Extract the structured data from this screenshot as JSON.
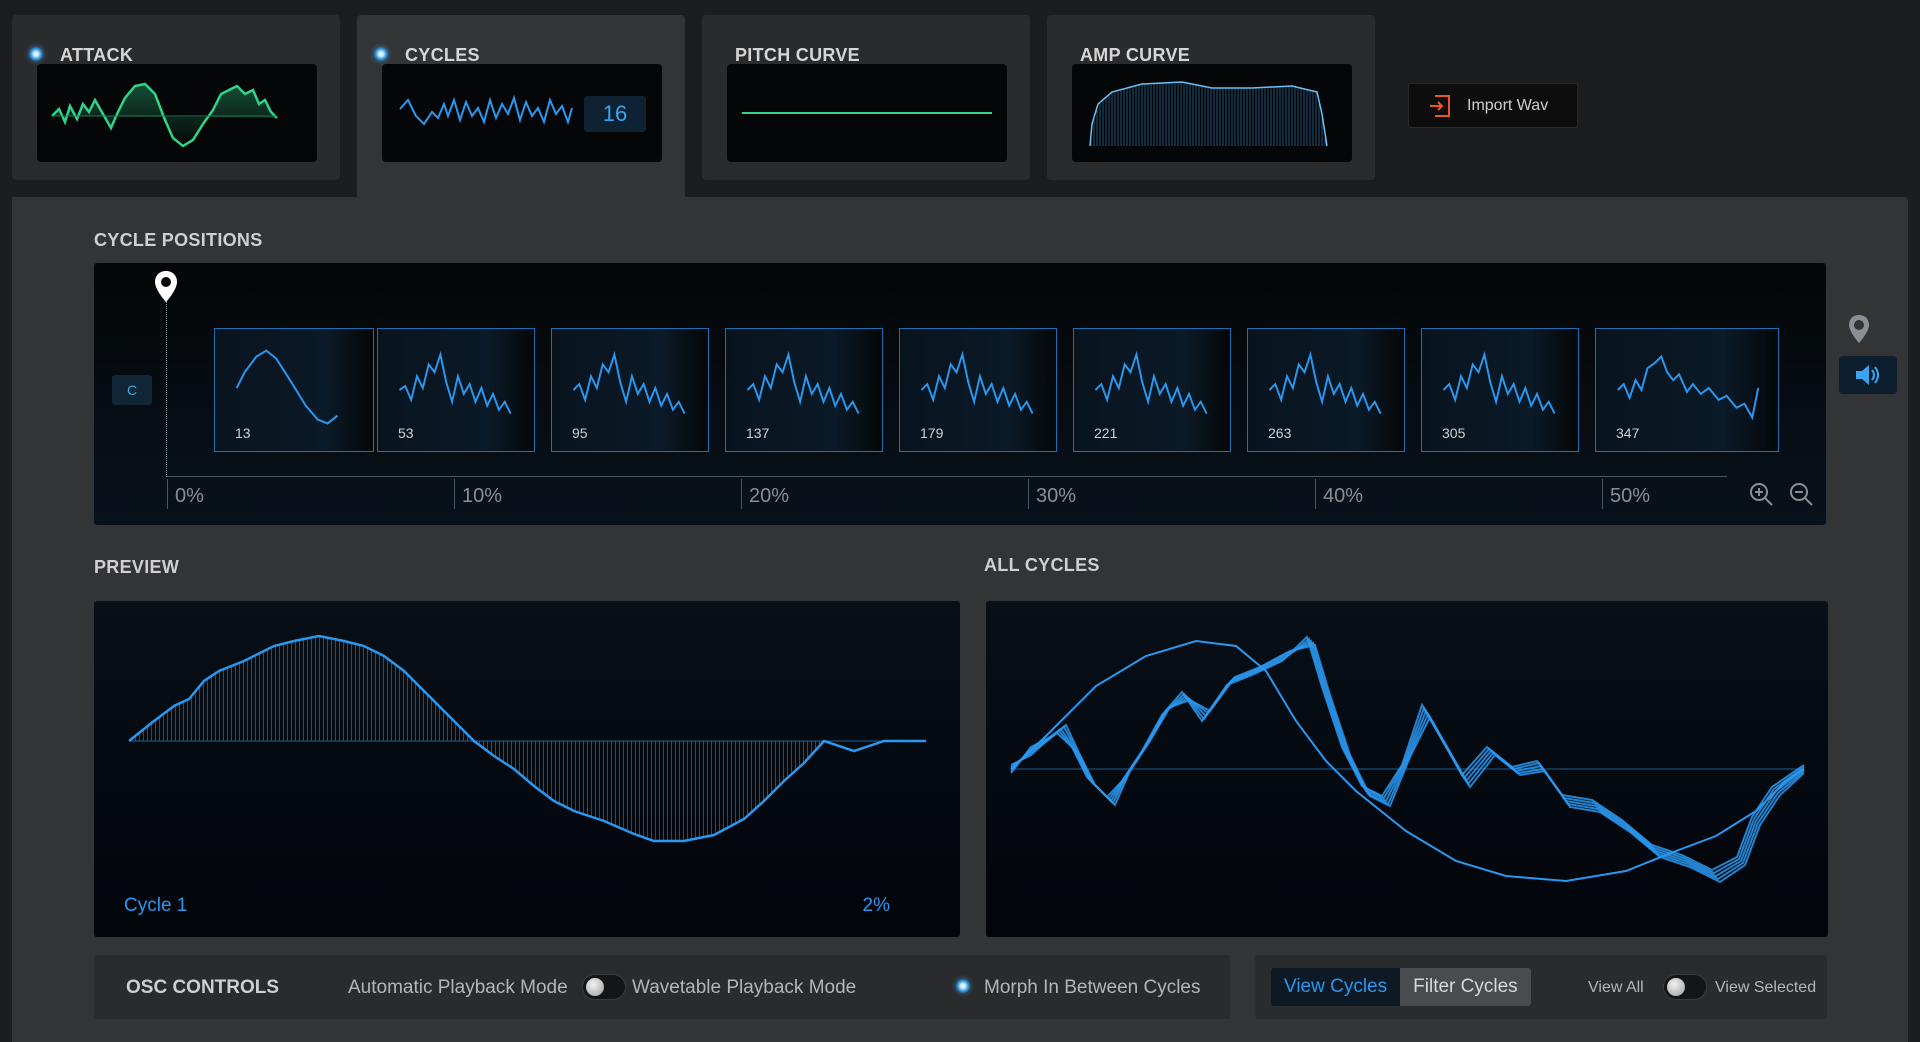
{
  "tabs": {
    "attack": {
      "title": "ATTACK"
    },
    "cycles": {
      "title": "CYCLES",
      "count": "16"
    },
    "pitch_curve": {
      "title": "PITCH CURVE"
    },
    "amp_curve": {
      "title": "AMP CURVE"
    }
  },
  "import": {
    "label": "Import Wav",
    "icon": "import-icon"
  },
  "cycle_positions": {
    "title": "CYCLE POSITIONS",
    "note_badge": "C",
    "frames": [
      "13",
      "53",
      "95",
      "137",
      "179",
      "221",
      "263",
      "305",
      "347"
    ],
    "ruler": [
      "0%",
      "10%",
      "20%",
      "30%",
      "40%",
      "50%"
    ],
    "zoom_in_icon": "zoom-in-icon",
    "zoom_out_icon": "zoom-out-icon"
  },
  "preview": {
    "title": "PREVIEW",
    "cycle_label": "Cycle 1",
    "percent": "2%"
  },
  "all_cycles": {
    "title": "ALL CYCLES"
  },
  "osc_controls": {
    "title": "OSC CONTROLS",
    "auto_mode": "Automatic Playback Mode",
    "wavetable_mode": "Wavetable Playback Mode",
    "morph": "Morph In Between Cycles"
  },
  "view": {
    "view_cycles": "View Cycles",
    "filter_cycles": "Filter Cycles",
    "view_all": "View All",
    "view_selected": "View Selected"
  },
  "colors": {
    "accent": "#2a98f0",
    "green": "#2fd38a",
    "panel": "#333436",
    "background": "#1c1d1f"
  }
}
